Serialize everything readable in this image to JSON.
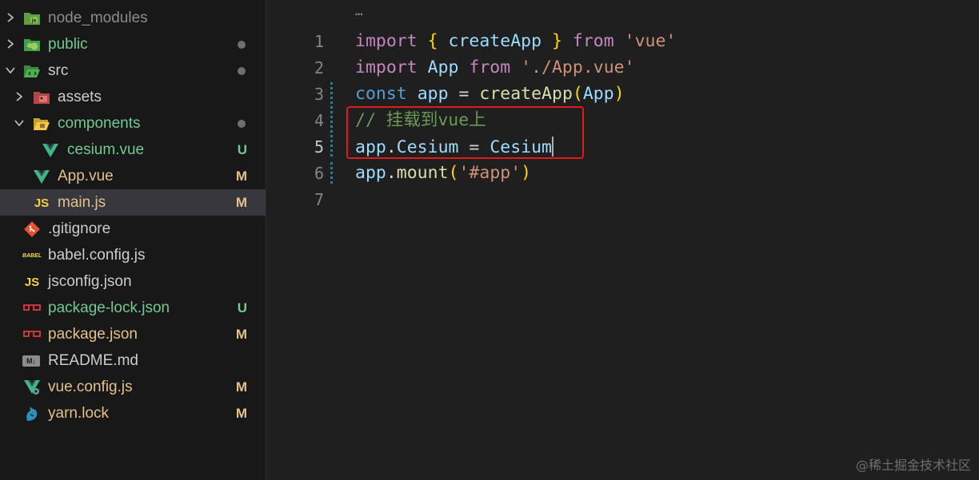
{
  "explorer": {
    "items": [
      {
        "name": "node_modules",
        "status": "",
        "dot": false,
        "color": "#cccccc"
      },
      {
        "name": "public",
        "status": "",
        "dot": true,
        "color": "#73c991"
      },
      {
        "name": "src",
        "status": "",
        "dot": true,
        "color": "#cccccc"
      },
      {
        "name": "assets",
        "status": "",
        "dot": false,
        "color": "#cccccc"
      },
      {
        "name": "components",
        "status": "",
        "dot": true,
        "color": "#73c991"
      },
      {
        "name": "cesium.vue",
        "status": "U",
        "dot": false,
        "color": "#73c991"
      },
      {
        "name": "App.vue",
        "status": "M",
        "dot": false,
        "color": "#e2c08d"
      },
      {
        "name": "main.js",
        "status": "M",
        "dot": false,
        "color": "#e2c08d"
      },
      {
        "name": ".gitignore",
        "status": "",
        "dot": false,
        "color": "#cccccc"
      },
      {
        "name": "babel.config.js",
        "status": "",
        "dot": false,
        "color": "#cccccc"
      },
      {
        "name": "jsconfig.json",
        "status": "",
        "dot": false,
        "color": "#cccccc"
      },
      {
        "name": "package-lock.json",
        "status": "U",
        "dot": false,
        "color": "#73c991"
      },
      {
        "name": "package.json",
        "status": "M",
        "dot": false,
        "color": "#e2c08d"
      },
      {
        "name": "README.md",
        "status": "",
        "dot": false,
        "color": "#cccccc"
      },
      {
        "name": "vue.config.js",
        "status": "M",
        "dot": false,
        "color": "#e2c08d"
      },
      {
        "name": "yarn.lock",
        "status": "M",
        "dot": false,
        "color": "#e2c08d"
      }
    ],
    "icons": {
      "js_label": "JS",
      "babel_label": "BABEL",
      "md_label": "M↓"
    }
  },
  "editor": {
    "fold_marker": "…",
    "line_numbers": [
      "1",
      "2",
      "3",
      "4",
      "5",
      "6",
      "7"
    ],
    "lines": {
      "l1": {
        "kw": "import",
        "b1": "{",
        "id": "createApp",
        "b2": "}",
        "from": "from",
        "str": "'vue'"
      },
      "l2": {
        "kw": "import",
        "id": "App",
        "from": "from",
        "str": "'./App.vue'"
      },
      "l3": {
        "kw": "const",
        "var": "app",
        "eq": "=",
        "fn": "createApp",
        "p1": "(",
        "arg": "App",
        "p2": ")"
      },
      "l4": {
        "comment": "// 挂载到vue上"
      },
      "l5": {
        "obj": "app",
        "dot": ".",
        "prop": "Cesium",
        "eq": "=",
        "val": "Cesium"
      },
      "l6": {
        "obj": "app",
        "dot": ".",
        "fn": "mount",
        "p1": "(",
        "str": "'#app'",
        "p2": ")"
      }
    }
  },
  "watermark": "@稀土掘金技术社区",
  "colors": {
    "sidebar_bg": "#181818",
    "editor_bg": "#1f1f1f",
    "selected_row": "#37373d",
    "untracked": "#73c991",
    "modified": "#e2c08d",
    "highlight_box": "#e01b1b"
  }
}
